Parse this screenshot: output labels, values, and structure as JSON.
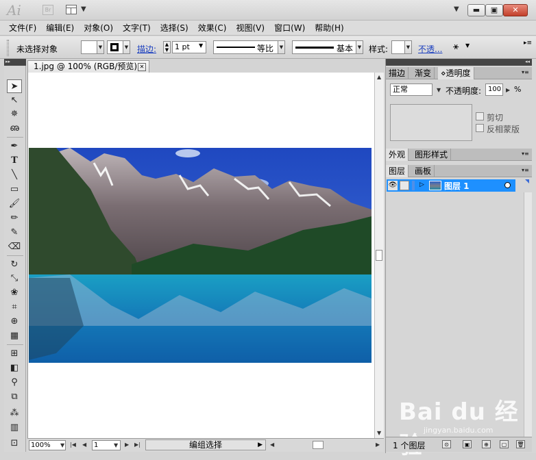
{
  "app": {
    "logo": "Ai",
    "bridge": "Br"
  },
  "menu": [
    "文件(F)",
    "编辑(E)",
    "对象(O)",
    "文字(T)",
    "选择(S)",
    "效果(C)",
    "视图(V)",
    "窗口(W)",
    "帮助(H)"
  ],
  "control": {
    "selection": "未选择对象",
    "stroke_label": "描边:",
    "stroke_weight": "1 pt",
    "profile": "等比",
    "brush": "基本",
    "style_label": "样式:",
    "opacity_link": "不透..."
  },
  "document": {
    "tab": "1.jpg @ 100% (RGB/预览)"
  },
  "status": {
    "zoom": "100%",
    "artboard": "1",
    "mode": "编组选择"
  },
  "panel_transparency": {
    "tabs": [
      "描边",
      "渐变",
      "透明度"
    ],
    "blend_mode": "正常",
    "opacity_label": "不透明度:",
    "opacity_value": "100",
    "percent": "%",
    "clip": "剪切",
    "invert": "反相蒙版"
  },
  "panel_appearance": {
    "tabs": [
      "外观",
      "图形样式"
    ]
  },
  "panel_layers": {
    "tabs": [
      "图层",
      "画板"
    ],
    "layer_name": "图层 1",
    "count": "1 个图层"
  },
  "watermark": {
    "main": "Bai du 经验",
    "sub": "jingyan.baidu.com"
  },
  "colors": {
    "layer_selection": "#1e90ff",
    "link": "#1b3fbf",
    "sky": "#2a55c6",
    "lake": "#1a8fb0"
  }
}
